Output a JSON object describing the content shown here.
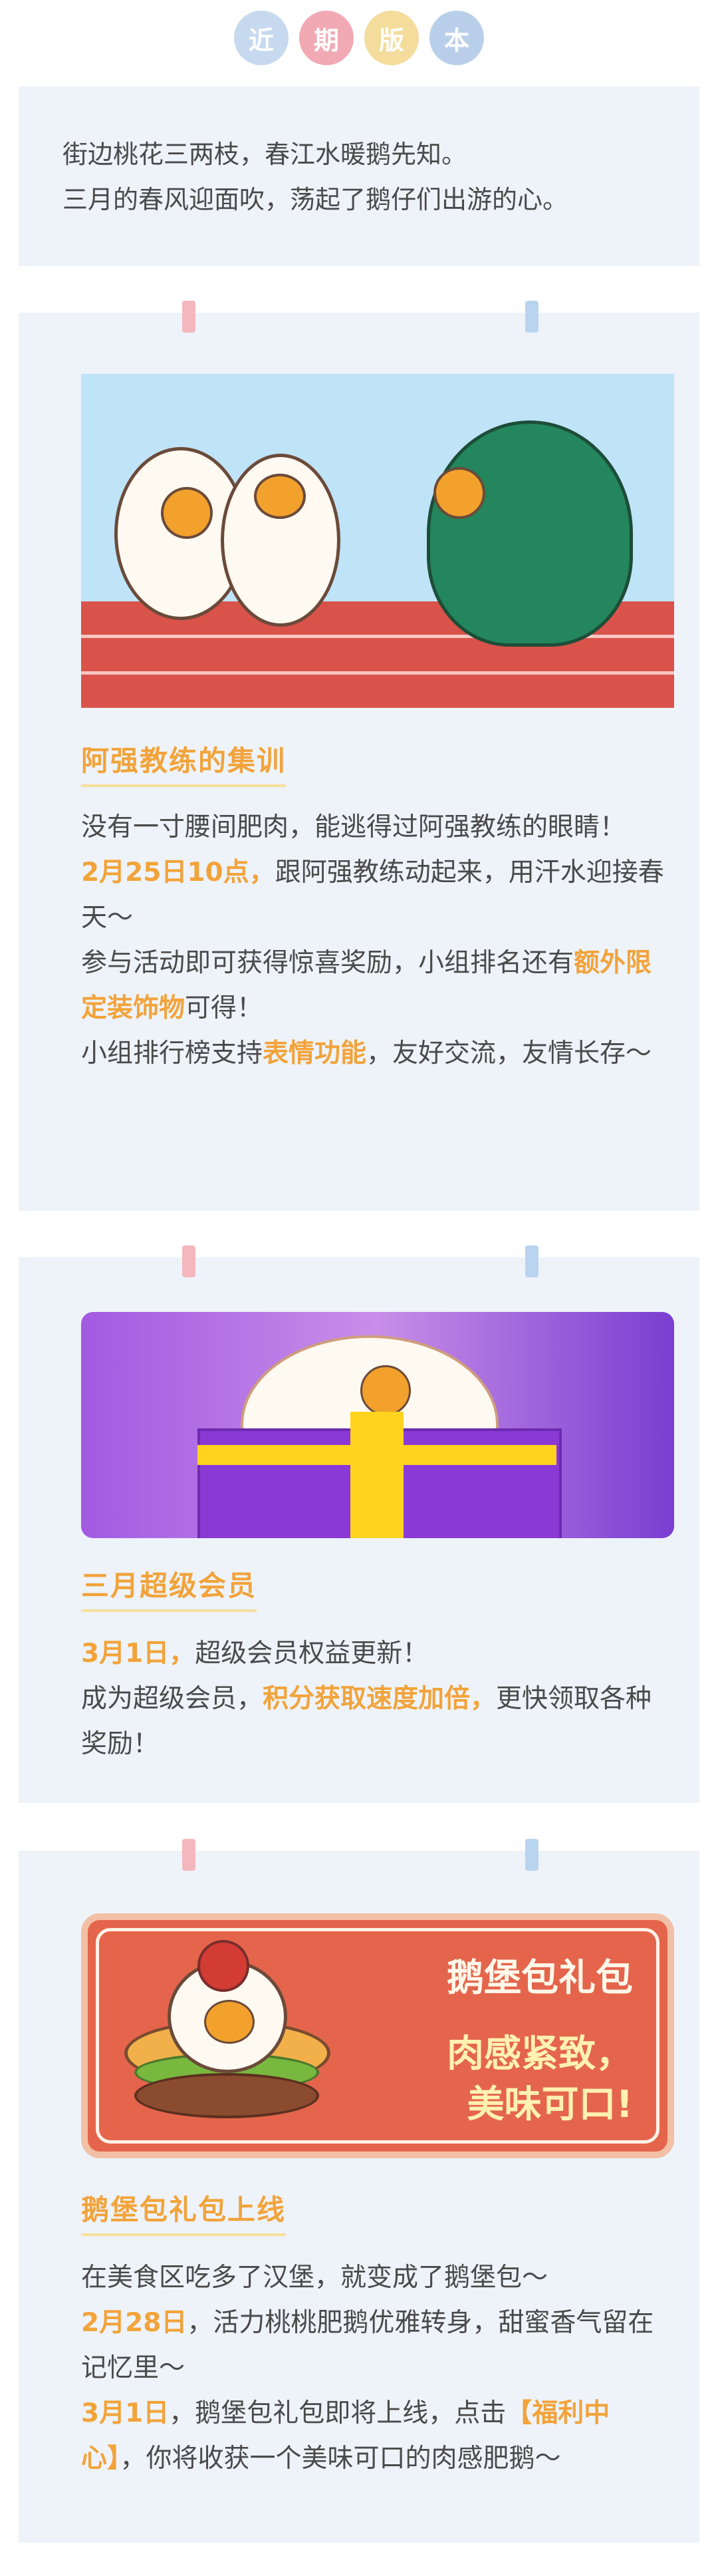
{
  "header": {
    "badges": [
      "近",
      "期",
      "版",
      "本"
    ]
  },
  "intro": {
    "line1": "街边桃花三两枝，春江水暖鹅先知。",
    "line2": "三月的春风迎面吹，荡起了鹅仔们出游的心。"
  },
  "card1": {
    "title": "阿强教练的集训",
    "p1": "没有一寸腰间肥肉，能逃得过阿强教练的眼睛！",
    "p2_hl": "2月25日10点，",
    "p2": "跟阿强教练动起来，用汗水迎接春天～",
    "p3a": "参与活动即可获得惊喜奖励，小组排名还有",
    "p3_hl": "额外限定装饰物",
    "p3b": "可得！",
    "p4a": "小组排行榜支持",
    "p4_hl": "表情功能",
    "p4b": "，友好交流，友情长存～"
  },
  "card2": {
    "title": "三月超级会员",
    "p1_hl": "3月1日，",
    "p1": "超级会员权益更新！",
    "p2a": "成为超级会员，",
    "p2_hl": "积分获取速度加倍，",
    "p2b": "更快领取各种奖励！"
  },
  "card3": {
    "banner_title": "鹅堡包礼包",
    "banner_sub1": "肉感紧致，",
    "banner_sub2": "美味可口!",
    "title": "鹅堡包礼包上线",
    "p1": "在美食区吃多了汉堡，就变成了鹅堡包～",
    "p2_hl": "2月28日",
    "p2": "，活力桃桃肥鹅优雅转身，甜蜜香气留在记忆里～",
    "p3_hl1": "3月1日",
    "p3a": "，鹅堡包礼包即将上线，点击",
    "p3_hl2": "【福利中心】",
    "p3b": "，你将收获一个美味可口的肉感肥鹅～"
  },
  "colors": {
    "accent": "#f2a33a",
    "card_bg": "#eef3fa",
    "pink": "#f3b7bd",
    "blue": "#b9d4ef"
  }
}
